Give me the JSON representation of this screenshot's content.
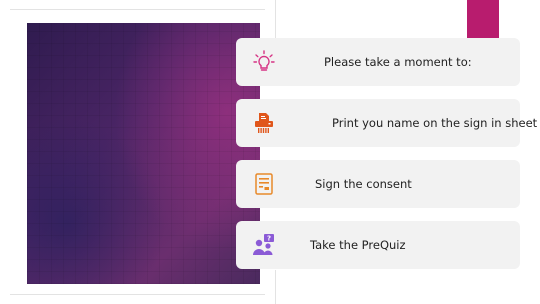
{
  "colors": {
    "accent": "#b81c6e",
    "icon_lightbulb": "#d63384",
    "icon_printer": "#e0561b",
    "icon_document": "#e8892a",
    "icon_people": "#8b5bd6"
  },
  "steps": [
    {
      "icon": "lightbulb-icon",
      "label": "Please take a moment to:"
    },
    {
      "icon": "printer-icon",
      "label": "Print you name on the sign in sheet"
    },
    {
      "icon": "document-icon",
      "label": "Sign the consent"
    },
    {
      "icon": "people-quiz-icon",
      "label": "Take the PreQuiz"
    }
  ]
}
